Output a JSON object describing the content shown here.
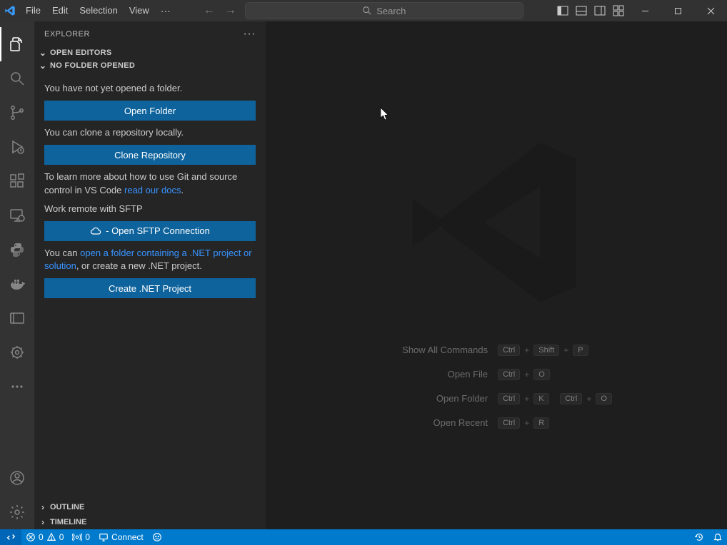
{
  "titlebar": {
    "menus": [
      "File",
      "Edit",
      "Selection",
      "View"
    ],
    "search_placeholder": "Search"
  },
  "sidebar": {
    "title": "EXPLORER",
    "open_editors": "OPEN EDITORS",
    "no_folder": "NO FOLDER OPENED",
    "msg_no_folder": "You have not yet opened a folder.",
    "btn_open_folder": "Open Folder",
    "msg_clone": "You can clone a repository locally.",
    "btn_clone": "Clone Repository",
    "msg_git1": "To learn more about how to use Git and source control in VS Code ",
    "link_git": "read our docs",
    "msg_git2": ".",
    "msg_sftp": "Work remote with SFTP",
    "btn_sftp": "- Open SFTP Connection",
    "msg_dotnet1": "You can ",
    "link_dotnet": "open a folder containing a .NET project or solution",
    "msg_dotnet2": ", or create a new .NET project.",
    "btn_dotnet": "Create .NET Project",
    "outline": "OUTLINE",
    "timeline": "TIMELINE"
  },
  "welcome": {
    "shortcuts": [
      {
        "label": "Show All Commands",
        "keys": [
          "Ctrl",
          "Shift",
          "P"
        ]
      },
      {
        "label": "Open File",
        "keys": [
          "Ctrl",
          "O"
        ]
      },
      {
        "label": "Open Folder",
        "keys": [
          "Ctrl",
          "K",
          "Ctrl",
          "O"
        ],
        "split": 2
      },
      {
        "label": "Open Recent",
        "keys": [
          "Ctrl",
          "R"
        ]
      }
    ]
  },
  "statusbar": {
    "errors": "0",
    "warnings": "0",
    "ports": "0",
    "connect": "Connect"
  }
}
